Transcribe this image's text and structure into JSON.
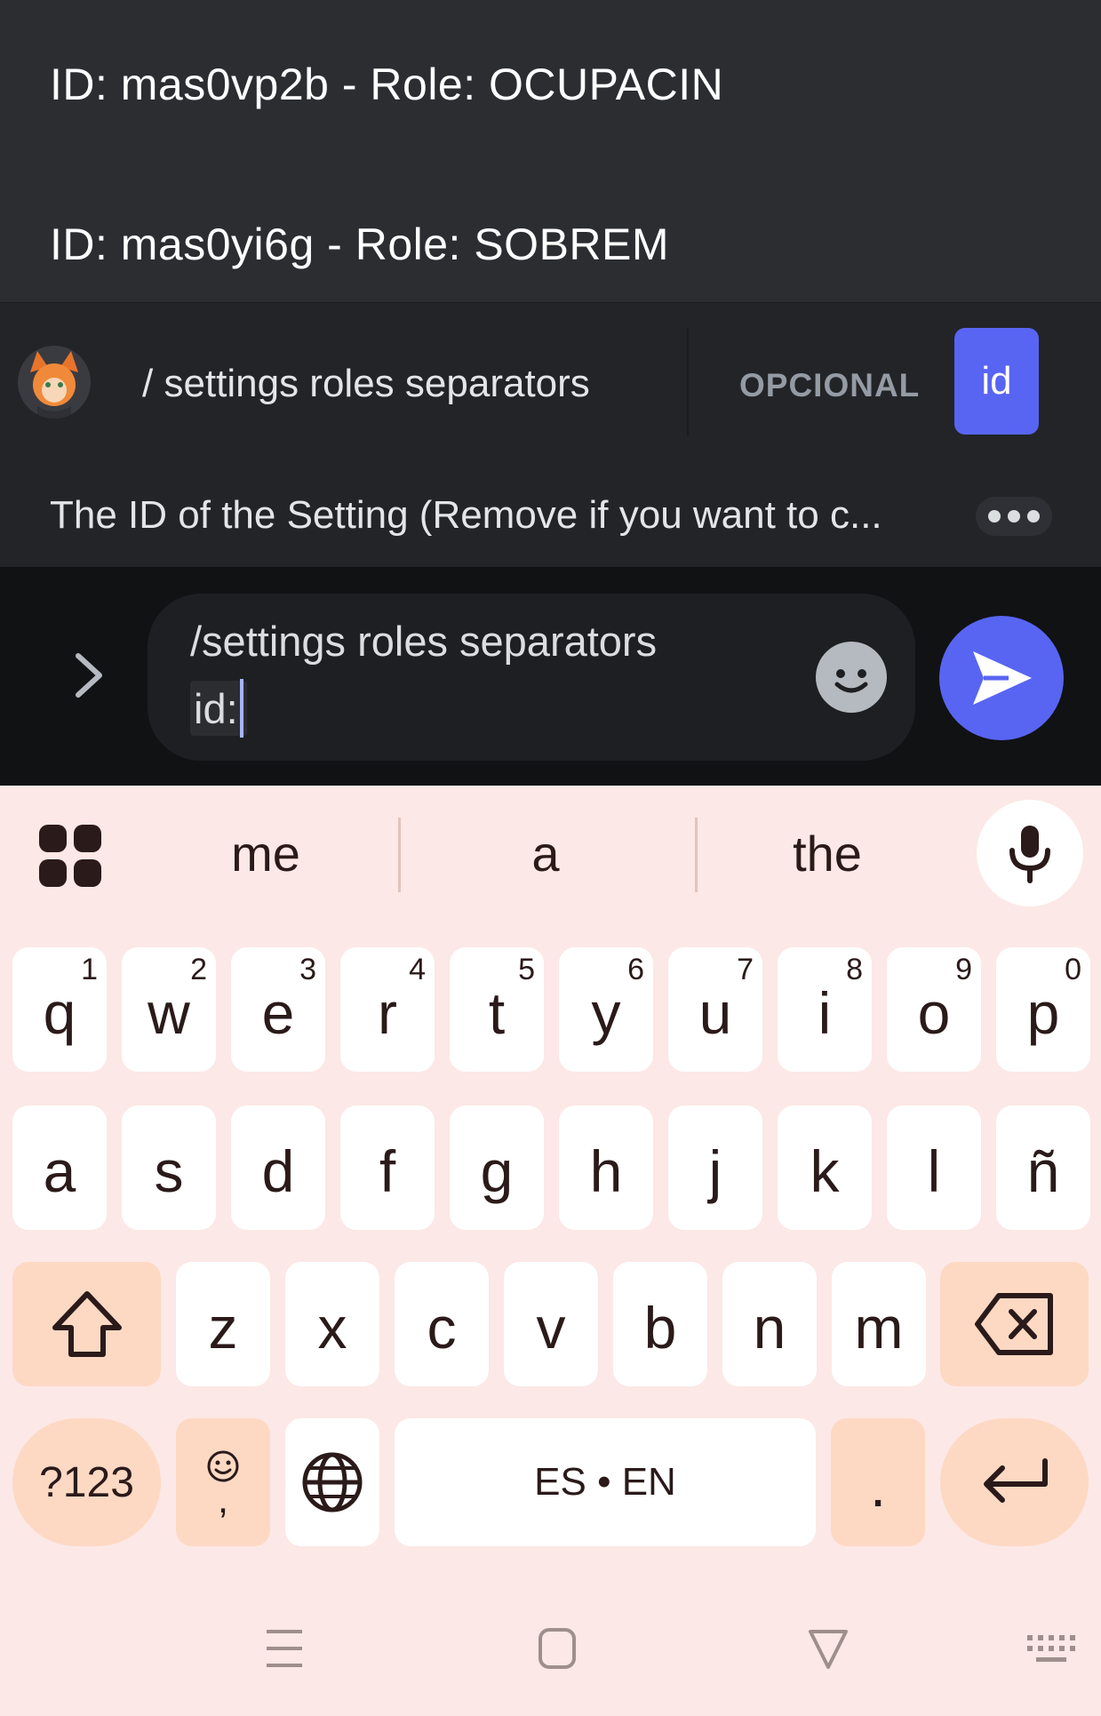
{
  "suggestions": [
    {
      "text": "ID: mas0vp2b - Role: OCUPACIN"
    },
    {
      "text": "ID: mas0yi6g - Role: SOBREM"
    }
  ],
  "command": {
    "name": "/ settings roles separators",
    "optional_label": "OPCIONAL",
    "option_chip": "id",
    "option_description": "The ID of the Setting (Remove if you want to c..."
  },
  "input": {
    "line1": "/settings roles separators",
    "line2": "id:"
  },
  "keyboard": {
    "suggestions": [
      "me",
      "a",
      "the"
    ],
    "row1": [
      {
        "k": "q",
        "h": "1"
      },
      {
        "k": "w",
        "h": "2"
      },
      {
        "k": "e",
        "h": "3"
      },
      {
        "k": "r",
        "h": "4"
      },
      {
        "k": "t",
        "h": "5"
      },
      {
        "k": "y",
        "h": "6"
      },
      {
        "k": "u",
        "h": "7"
      },
      {
        "k": "i",
        "h": "8"
      },
      {
        "k": "o",
        "h": "9"
      },
      {
        "k": "p",
        "h": "0"
      }
    ],
    "row2": [
      "a",
      "s",
      "d",
      "f",
      "g",
      "h",
      "j",
      "k",
      "l",
      "ñ"
    ],
    "row3": [
      "z",
      "x",
      "c",
      "v",
      "b",
      "n",
      "m"
    ],
    "symbols_label": "?123",
    "emoji_comma_label": ",",
    "space_label": "ES • EN",
    "period_label": "."
  },
  "colors": {
    "accent": "#5865f2",
    "panel_dark": "#2b2d31",
    "keyboard_bg": "#fce8e6",
    "mod_key": "#fdd9c4"
  }
}
